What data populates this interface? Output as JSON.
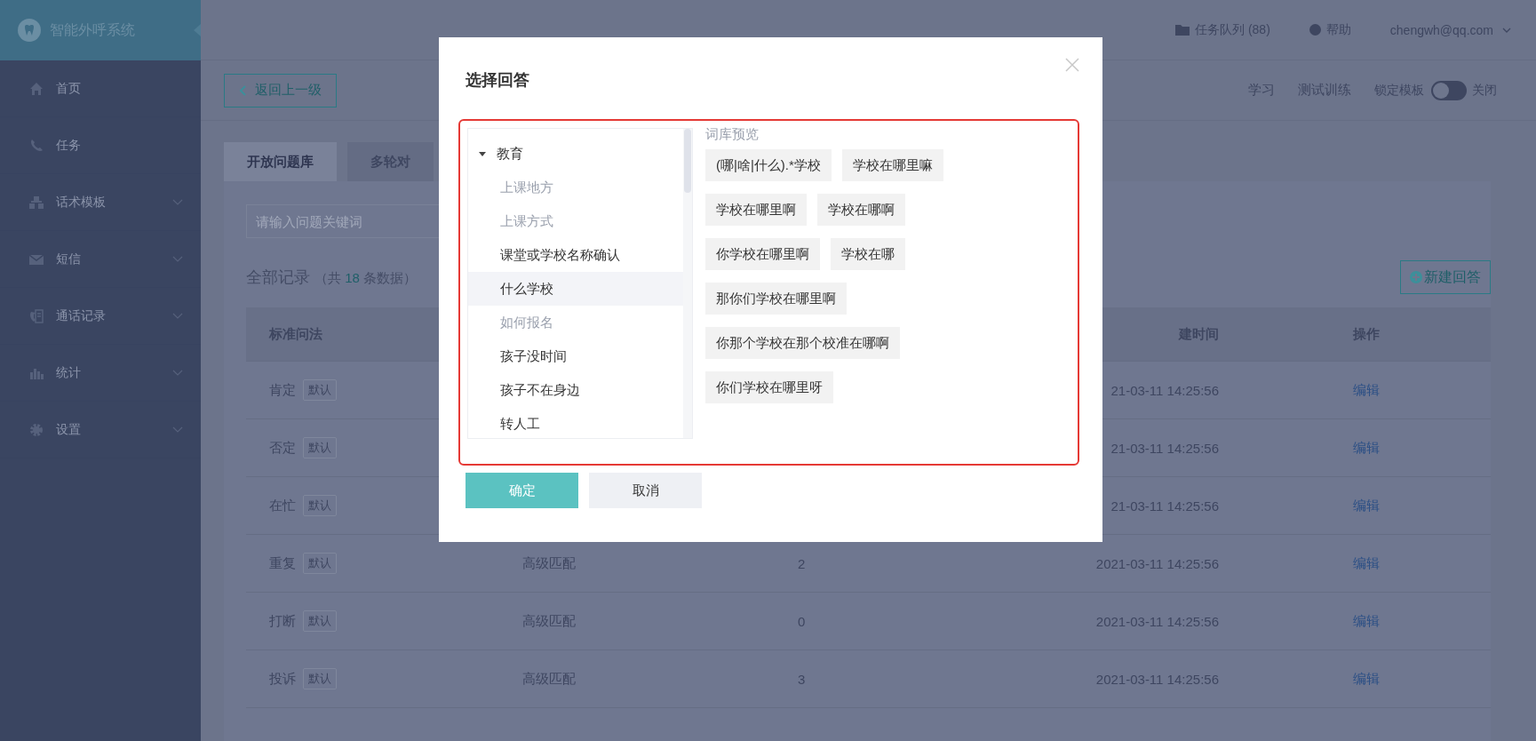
{
  "app": {
    "title": "智能外呼系统"
  },
  "sidebar": {
    "items": [
      {
        "label": "首页",
        "kind": "link"
      },
      {
        "label": "任务",
        "kind": "link"
      },
      {
        "label": "话术模板",
        "kind": "group"
      },
      {
        "label": "短信",
        "kind": "group"
      },
      {
        "label": "通话记录",
        "kind": "group"
      },
      {
        "label": "统计",
        "kind": "group"
      },
      {
        "label": "设置",
        "kind": "group"
      }
    ]
  },
  "header": {
    "queue": "任务队列 (88)",
    "help": "帮助",
    "user": "chengwh@qq.com"
  },
  "subbar": {
    "back": "返回上一级",
    "nav": [
      "学习",
      "测试训练"
    ],
    "lock_label": "锁定模板",
    "lock_on": false,
    "lock_state": "关闭"
  },
  "tabs": [
    {
      "label": "开放问题库",
      "selected": true
    },
    {
      "label": "多轮对",
      "selected": false
    }
  ],
  "search": {
    "placeholder": "请输入问题关键词"
  },
  "records": {
    "title": "全部记录",
    "prefix": "（共",
    "count": "18",
    "suffix": "条数据）",
    "new_button": "新建回答"
  },
  "table": {
    "header": {
      "name": "标准问法",
      "time": "建时间",
      "action": "操作"
    },
    "rows": [
      {
        "name": "肯定",
        "tag": "默认",
        "time": "21-03-11 14:25:56",
        "action": "编辑"
      },
      {
        "name": "否定",
        "tag": "默认",
        "time": "21-03-11 14:25:56",
        "action": "编辑"
      },
      {
        "name": "在忙",
        "tag": "默认",
        "time": "21-03-11 14:25:56",
        "action": "编辑"
      },
      {
        "name": "重复",
        "tag": "默认",
        "match": "高级匹配",
        "count": "2",
        "time": "2021-03-11 14:25:56",
        "action": "编辑"
      },
      {
        "name": "打断",
        "tag": "默认",
        "match": "高级匹配",
        "count": "0",
        "time": "2021-03-11 14:25:56",
        "action": "编辑"
      },
      {
        "name": "投诉",
        "tag": "默认",
        "match": "高级匹配",
        "count": "3",
        "time": "2021-03-11 14:25:56",
        "action": "编辑"
      }
    ]
  },
  "dialog": {
    "title": "选择回答",
    "tree": [
      {
        "label": "教育",
        "expanded": true,
        "children": [
          {
            "label": "上课地方",
            "disabled": true,
            "selected": false
          },
          {
            "label": "上课方式",
            "disabled": true,
            "selected": false
          },
          {
            "label": "课堂或学校名称确认",
            "disabled": false,
            "selected": false
          },
          {
            "label": "什么学校",
            "disabled": false,
            "selected": true
          },
          {
            "label": "如何报名",
            "disabled": true,
            "selected": false
          },
          {
            "label": "孩子没时间",
            "disabled": false,
            "selected": false
          },
          {
            "label": "孩子不在身边",
            "disabled": false,
            "selected": false
          },
          {
            "label": "转人工",
            "disabled": false,
            "selected": false
          }
        ]
      }
    ],
    "preview_title": "词库预览",
    "phrases": [
      [
        "(哪|啥|什么).*学校",
        "学校在哪里嘛"
      ],
      [
        "学校在哪里啊",
        "学校在哪啊"
      ],
      [
        "你学校在哪里啊",
        "学校在哪"
      ],
      [
        "那你们学校在哪里啊"
      ],
      [
        "你那个学校在那个校准在哪啊"
      ],
      [
        "你们学校在哪里呀"
      ]
    ],
    "buttons": [
      {
        "label": "确定",
        "kind": "primary"
      },
      {
        "label": "取消",
        "kind": "secondary"
      }
    ]
  }
}
